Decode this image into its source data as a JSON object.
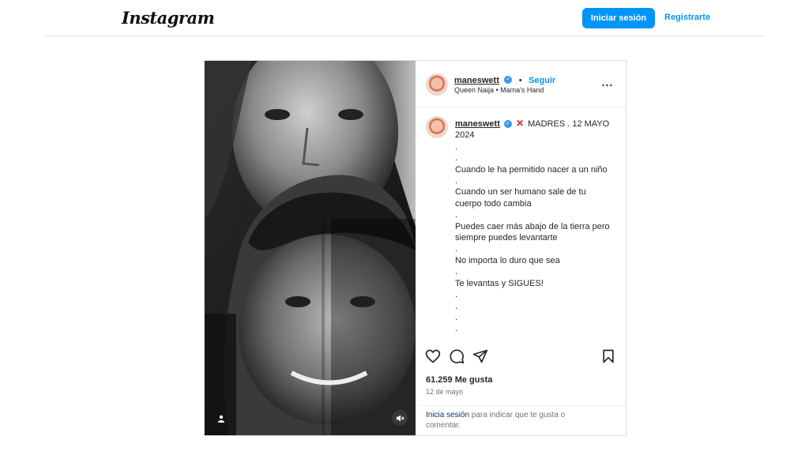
{
  "header": {
    "logo_text": "Instagram",
    "login_label": "Iniciar sesión",
    "signup_label": "Registrarte",
    "accent_color": "#0095f6"
  },
  "post": {
    "username": "maneswett",
    "verified": true,
    "separator": "•",
    "follow_label": "Seguir",
    "audio": "Queen Naija • Mama's Hand",
    "more_label": "...",
    "media_icons": [
      "user-tag-icon",
      "mute-icon"
    ],
    "caption": {
      "username": "maneswett",
      "title": "MADRES . 12 MAYO 2024",
      "lines": [
        ".",
        ".",
        "Cuando le ha permitido nacer a un niño",
        ".",
        "Cuando un ser humano sale de tu cuerpo todo cambia",
        ".",
        "Puedes caer más abajo de la tierra pero siempre puedes levantarte",
        ".",
        "No importa lo duro que sea",
        ".",
        "Te levantas y SIGUES!",
        ".",
        ".",
        ".",
        "."
      ]
    },
    "action_icons": [
      "heart-icon",
      "comment-icon",
      "share-icon",
      "bookmark-icon"
    ],
    "likes": "61.259 Me gusta",
    "date": "12 de mayo",
    "login_prompt": {
      "link": "Inicia sesión",
      "text": " para indicar que te gusta o comentar."
    }
  }
}
